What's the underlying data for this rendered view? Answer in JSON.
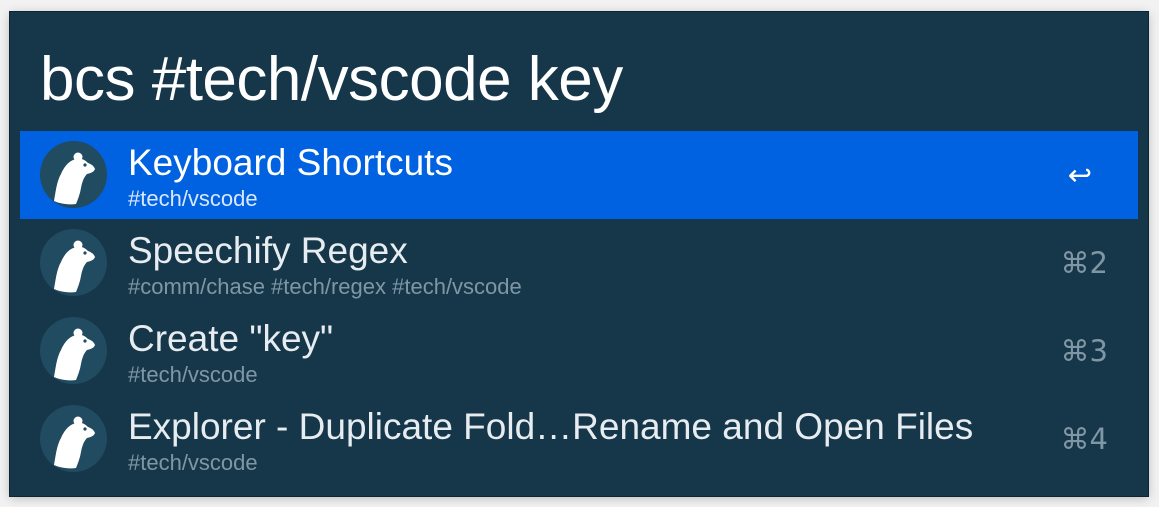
{
  "search": {
    "query": "bcs #tech/vscode key"
  },
  "results": [
    {
      "title": "Keyboard Shortcuts",
      "subtitle": "#tech/vscode",
      "shortcut": "↩",
      "icon": "bear-icon",
      "selected": true
    },
    {
      "title": "Speechify Regex",
      "subtitle": "#comm/chase #tech/regex #tech/vscode",
      "shortcut": "⌘2",
      "icon": "bear-icon",
      "selected": false
    },
    {
      "title": "Create \"key\"",
      "subtitle": "#tech/vscode",
      "shortcut": "⌘3",
      "icon": "bear-icon",
      "selected": false
    },
    {
      "title": "Explorer - Duplicate Fold…Rename and Open Files",
      "subtitle": "#tech/vscode",
      "shortcut": "⌘4",
      "icon": "bear-icon",
      "selected": false
    }
  ],
  "colors": {
    "background": "#16374a",
    "selection": "#0062e0",
    "subtitle": "#7f97a5",
    "text": "#ffffff"
  }
}
